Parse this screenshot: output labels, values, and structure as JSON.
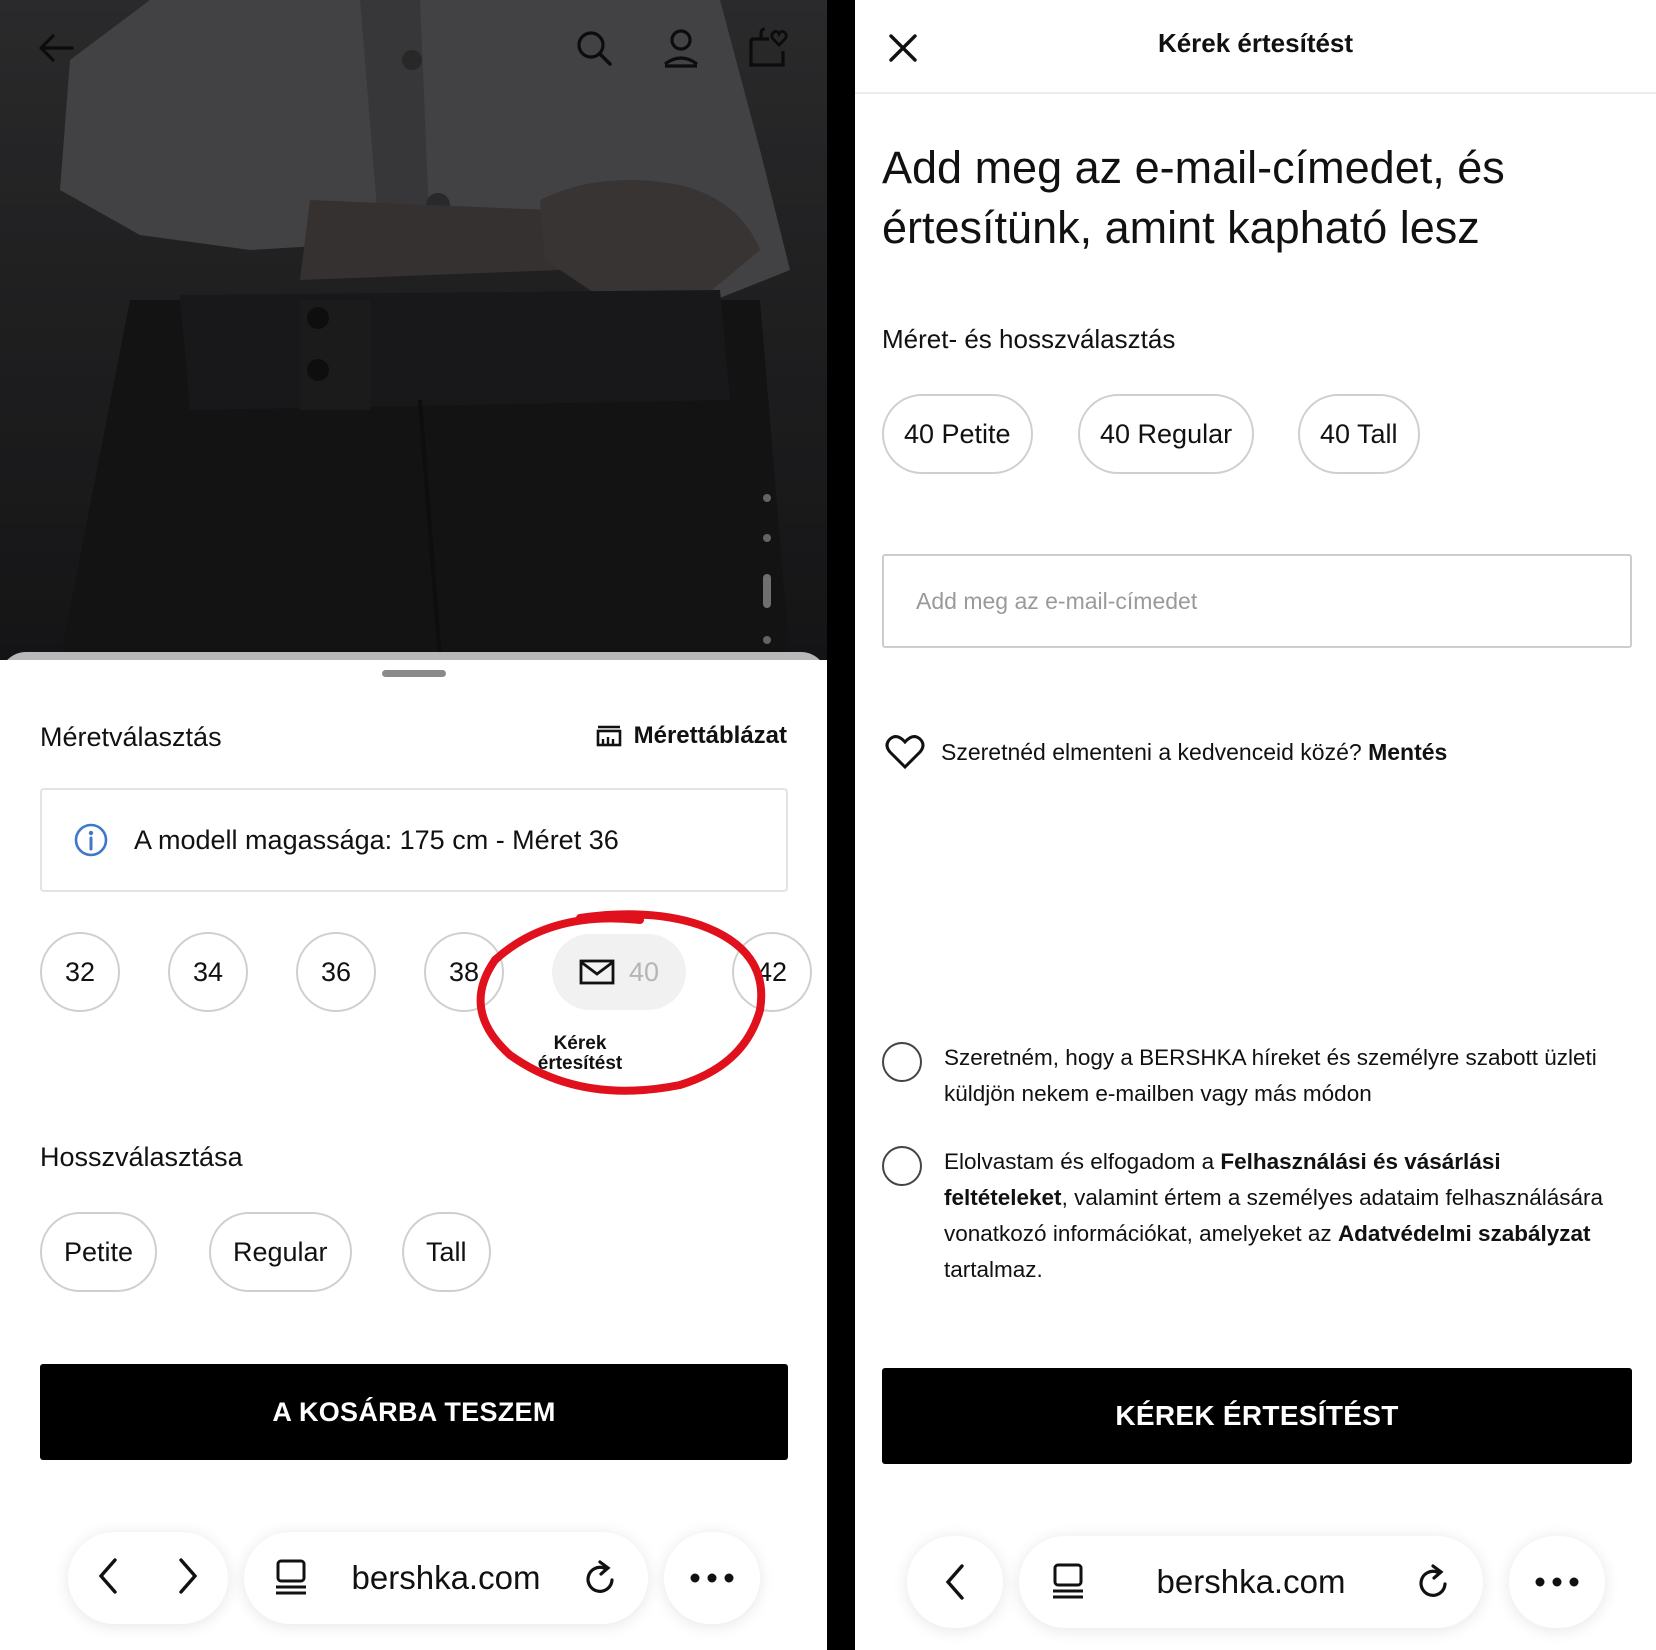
{
  "left": {
    "header": {
      "back_icon": "arrow-left-icon",
      "search_icon": "search-icon",
      "account_icon": "user-icon",
      "bag_icon": "bag-heart-icon"
    },
    "size_section": {
      "title": "Méretválasztás",
      "size_chart_label": "Mérettáblázat",
      "model_info": "A modell magassága: 175 cm - Méret 36",
      "sizes": [
        "32",
        "34",
        "36",
        "38",
        "40",
        "42"
      ],
      "unavailable_size": "40",
      "notify_label": "Kérek értesítést"
    },
    "length_section": {
      "title": "Hosszválasztása",
      "options": [
        "Petite",
        "Regular",
        "Tall"
      ]
    },
    "add_to_cart": "A KOSÁRBA TESZEM",
    "annotation_color": "#e0101c"
  },
  "right": {
    "title": "Kérek értesítést",
    "headline": "Add meg az e-mail-címedet, és értesítünk, amint kapható lesz",
    "selection_label": "Méret- és hosszválasztás",
    "options": [
      "40 Petite",
      "40 Regular",
      "40 Tall"
    ],
    "email_placeholder": "Add meg az e-mail-címedet",
    "favorites_text": "Szeretnéd elmenteni a kedvenceid közé?",
    "favorites_action": "Mentés",
    "consent_marketing": "Szeretném, hogy a BERSHKA híreket és személyre szabott üzleti küldjön nekem e-mailben vagy más módon",
    "consent_terms": {
      "part1": "Elolvastam és elfogadom a ",
      "terms_link": "Felhasználási és vásárlási feltételeket",
      "part2": ", valamint értem a személyes adataim felhasználására vonatkozó információkat, amelyeket az ",
      "privacy_link": "Adatvédelmi szabályzat",
      "part3": " tartalmaz."
    },
    "submit": "KÉREK ÉRTESÍTÉST"
  },
  "browser": {
    "url": "bershka.com"
  }
}
